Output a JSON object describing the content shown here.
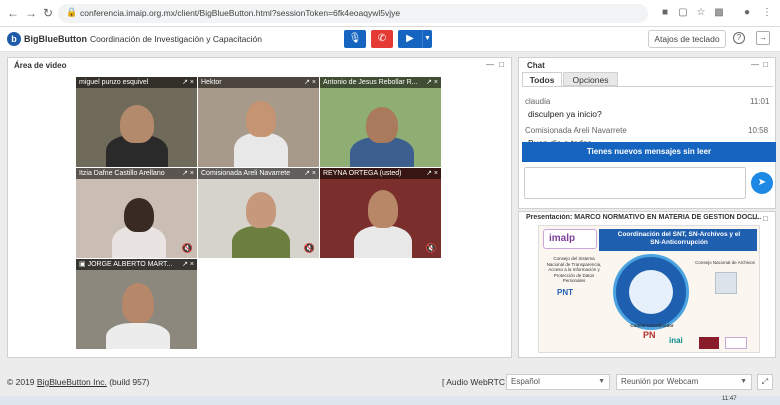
{
  "browser": {
    "url": "conferencia.imaip.org.mx/client/BigBlueButton.html?sessionToken=6fk4eoaqywl5vjye"
  },
  "header": {
    "app_name": "BigBlueButton",
    "meeting_title": "Coordinación de Investigación y Capacitación",
    "shortcuts_label": "Atajos de teclado"
  },
  "video": {
    "title": "Área de video",
    "tiles": [
      {
        "name": "miguel punzo esquivel"
      },
      {
        "name": "Hektor"
      },
      {
        "name": "Antonio de Jesus Rebollar R..."
      },
      {
        "name": "Itzia Dafne Castillo Arellano"
      },
      {
        "name": "Comisionada Areli Navarrete"
      },
      {
        "name": "REYNA ORTEGA (usted)"
      },
      {
        "name": "JORGE ALBERTO MART..."
      }
    ]
  },
  "chat": {
    "title": "Chat",
    "tab_all": "Todos",
    "tab_options": "Opciones",
    "messages": [
      {
        "author": "claudia",
        "time": "11:01",
        "text": "disculpen ya inicio?"
      },
      {
        "author": "Comisionada Areli Navarrete",
        "time": "10:58",
        "text": "Buen dia a todos"
      }
    ],
    "new_messages_label": "Tienes nuevos mensajes sin leer"
  },
  "presentation": {
    "title": "Presentación: MARCO NORMATIVO EN MATERIA DE GESTION DOCU...",
    "slide": {
      "logo": "imalp",
      "heading_line1": "Coordinación del SNT, SN-Archivos y el",
      "heading_line2": "SN-Anticorrupción",
      "left_text": "Consejo del Sistema Nacional de Transparencia, Acceso a la Información y Protección de Datos Personales",
      "right_text": "Consejo Nacional de Archivos",
      "bottom_text": "Comité Coordinador",
      "pnt": "PNT",
      "pn": "PN",
      "inai": "inai"
    }
  },
  "footer": {
    "copyright_prefix": "© 2019 ",
    "copyright_link": "BigBlueButton Inc.",
    "copyright_suffix": " (build 957)",
    "audio_label": "[ Audio WebRTC ]",
    "language": "Español",
    "join_mode": "Reunión por Webcam"
  },
  "taskbar": {
    "time": "11:47"
  }
}
